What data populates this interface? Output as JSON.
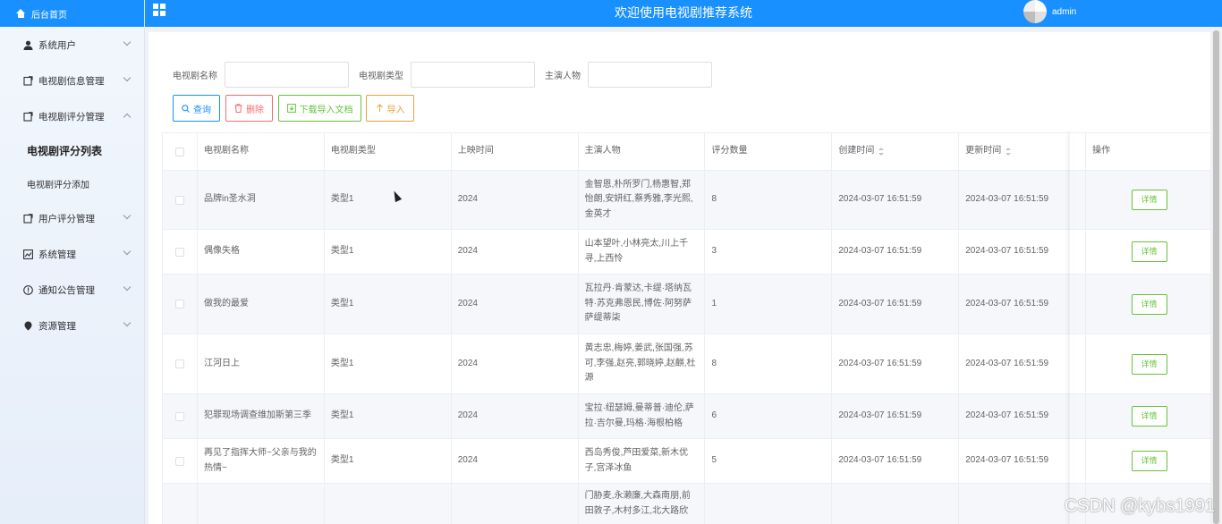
{
  "sidebar": {
    "home": "后台首页",
    "menu": [
      {
        "label": "系统用户",
        "icon": "user-icon"
      },
      {
        "label": "电视剧信息管理",
        "icon": "doc-icon"
      },
      {
        "label": "电视剧评分管理",
        "icon": "doc-icon",
        "open": true
      },
      {
        "label": "用户评分管理",
        "icon": "doc-icon"
      },
      {
        "label": "系统管理",
        "icon": "chart-icon"
      },
      {
        "label": "通知公告管理",
        "icon": "info-icon"
      },
      {
        "label": "资源管理",
        "icon": "pin-icon"
      }
    ],
    "sub": [
      "电视剧评分列表",
      "电视剧评分添加"
    ]
  },
  "header": {
    "title": "欢迎使用电视剧推荐系统",
    "user": "admin"
  },
  "search": {
    "labels": [
      "电视剧名称",
      "电视剧类型",
      "主演人物"
    ],
    "values": [
      "",
      "",
      ""
    ]
  },
  "buttons": {
    "query": "查询",
    "delete": "删除",
    "download": "下载导入文档",
    "import": "导入"
  },
  "table": {
    "headers": [
      "电视剧名称",
      "电视剧类型",
      "上映时间",
      "主演人物",
      "评分数量",
      "创建时间",
      "更新时间",
      "操作"
    ],
    "detail_label": "详情",
    "rows": [
      [
        "品牌in圣水洞",
        "类型1",
        "2024",
        "金智恩,朴所罗门,杨惠智,郑怡朗,安妍红,蔡秀雅,李光熙,金英才",
        "8",
        "2024-03-07 16:51:59",
        "2024-03-07 16:51:59"
      ],
      [
        "偶像失格",
        "类型1",
        "2024",
        "山本望叶,小林亮太,川上千寻,上西怜",
        "3",
        "2024-03-07 16:51:59",
        "2024-03-07 16:51:59"
      ],
      [
        "做我的最爱",
        "类型1",
        "2024",
        "瓦拉丹·肯蒙达,卡缇·塔纳瓦特·苏克弗恩民,博佐·阿努萨萨缇蒂柒",
        "1",
        "2024-03-07 16:51:59",
        "2024-03-07 16:51:59"
      ],
      [
        "江河日上",
        "类型1",
        "2024",
        "黄志忠,梅婷,姜武,张国强,苏可,李强,赵亮,郭晓婷,赵麒,杜源",
        "8",
        "2024-03-07 16:51:59",
        "2024-03-07 16:51:59"
      ],
      [
        "犯罪现场调查维加斯第三季",
        "类型1",
        "2024",
        "宝拉·纽瑟姆,曼蒂普·迪伦,萨拉·吉尔曼,玛格·海根柏格",
        "6",
        "2024-03-07 16:51:59",
        "2024-03-07 16:51:59"
      ],
      [
        "再见了指挥大师~父亲与我的热情~",
        "类型1",
        "2024",
        "西岛秀俊,芦田爱菜,新木优子,宫泽冰鱼",
        "5",
        "2024-03-07 16:51:59",
        "2024-03-07 16:51:59"
      ],
      [
        "",
        "",
        "",
        "门胁麦,永濑廉,大森南朋,前田敦子,木村多江,北大路欣",
        "",
        "",
        ""
      ]
    ]
  },
  "watermark": "CSDN @kybs1991"
}
